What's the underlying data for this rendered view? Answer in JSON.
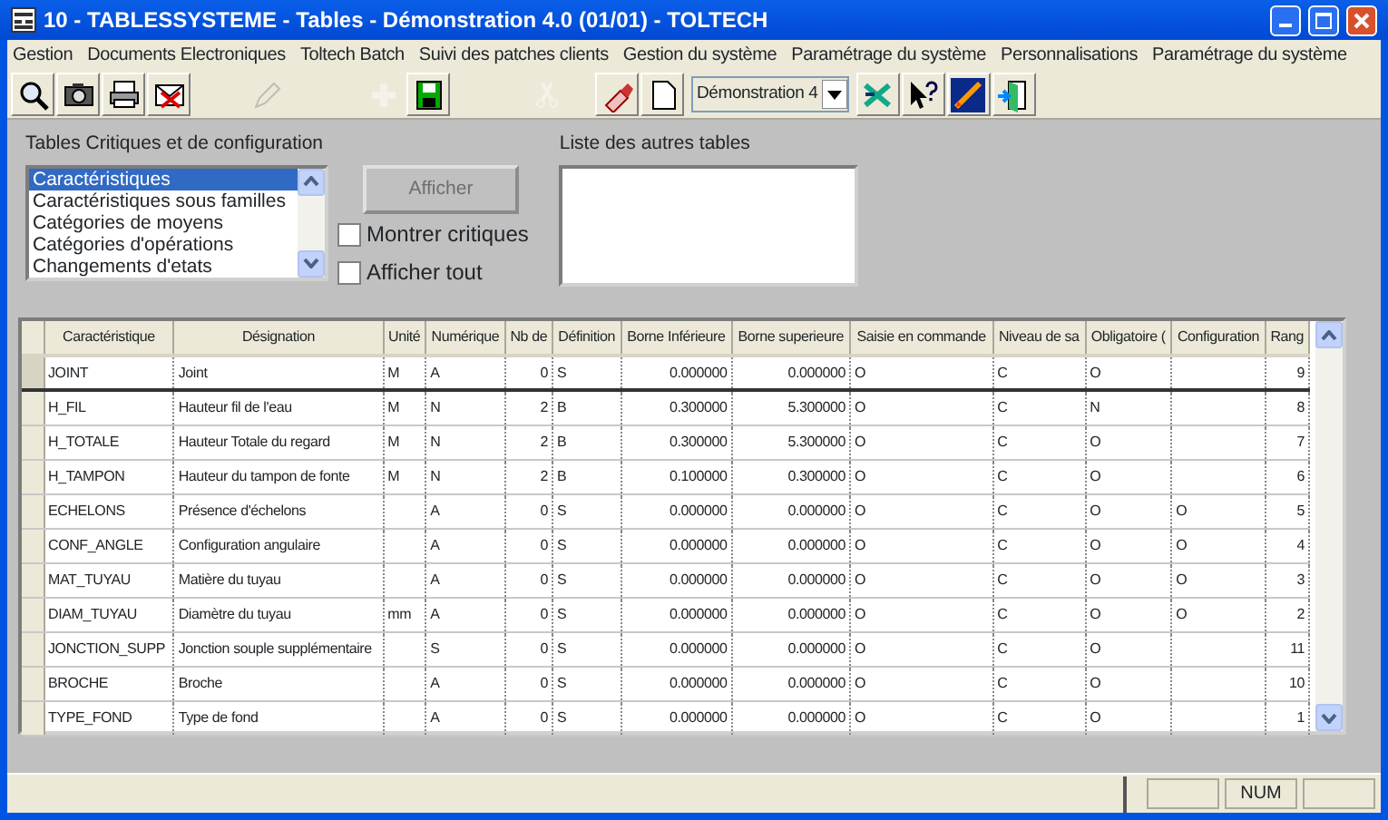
{
  "window": {
    "title": "10 - TABLESSYSTEME - Tables - Démonstration 4.0 (01/01) - TOLTECH"
  },
  "menu": [
    {
      "label": "Gestion"
    },
    {
      "label": "Documents Electroniques"
    },
    {
      "label": "Toltech Batch"
    },
    {
      "label": "Suivi des patches clients"
    },
    {
      "label": "Gestion du système"
    },
    {
      "label": "Paramétrage du système"
    },
    {
      "label": "Personnalisations"
    },
    {
      "label": "Paramétrage du système"
    }
  ],
  "toolbar": [
    {
      "disabled": false
    },
    {
      "disabled": false
    },
    {
      "disabled": false
    },
    {
      "disabled": false
    },
    {
      "disabled": true
    },
    {
      "disabled": true
    },
    {
      "disabled": false
    },
    {
      "disabled": true
    },
    {
      "disabled": false
    },
    {
      "disabled": false
    }
  ],
  "database_select": {
    "value": "Démonstration 4"
  },
  "toolbar_right": [
    {
      "disabled": false
    },
    {
      "disabled": false
    },
    {
      "disabled": false
    },
    {
      "disabled": false
    }
  ],
  "critical_tables": {
    "label": "Tables Critiques et de configuration",
    "items": [
      {
        "label": "Caractéristiques",
        "selected": true
      },
      {
        "label": "Caractéristiques sous familles",
        "selected": false
      },
      {
        "label": "Catégories de moyens",
        "selected": false
      },
      {
        "label": "Catégories d'opérations",
        "selected": false
      },
      {
        "label": "Changements d'etats",
        "selected": false
      }
    ]
  },
  "show_button": {
    "label": "Afficher",
    "disabled": true
  },
  "checkboxes": [
    {
      "label": "Montrer critiques",
      "checked": false
    },
    {
      "label": "Afficher tout",
      "checked": false
    }
  ],
  "other_tables": {
    "label": "Liste des autres tables"
  },
  "table": {
    "columns": [
      "Caractéristique",
      "Désignation",
      "Unité",
      "Numérique",
      "Nb de",
      "Définition",
      "Borne Inférieure",
      "Borne superieure",
      "Saisie en commande",
      "Niveau de sa",
      "Obligatoire (",
      "Configuration",
      "Rang"
    ],
    "rows": [
      {
        "selected": true,
        "cells": [
          "JOINT",
          "Joint",
          "M",
          "A",
          "0",
          "S",
          "0.000000",
          "0.000000",
          "O",
          "C",
          "O",
          "",
          "9"
        ]
      },
      {
        "selected": false,
        "cells": [
          "H_FIL",
          "Hauteur fil de l'eau",
          "M",
          "N",
          "2",
          "B",
          "0.300000",
          "5.300000",
          "O",
          "C",
          "N",
          "",
          "8"
        ]
      },
      {
        "selected": false,
        "cells": [
          "H_TOTALE",
          "Hauteur Totale du regard",
          "M",
          "N",
          "2",
          "B",
          "0.300000",
          "5.300000",
          "O",
          "C",
          "O",
          "",
          "7"
        ]
      },
      {
        "selected": false,
        "cells": [
          "H_TAMPON",
          "Hauteur du tampon de fonte",
          "M",
          "N",
          "2",
          "B",
          "0.100000",
          "0.300000",
          "O",
          "C",
          "O",
          "",
          "6"
        ]
      },
      {
        "selected": false,
        "cells": [
          "ECHELONS",
          "Présence d'échelons",
          "",
          "A",
          "0",
          "S",
          "0.000000",
          "0.000000",
          "O",
          "C",
          "O",
          "O",
          "5"
        ]
      },
      {
        "selected": false,
        "cells": [
          "CONF_ANGLE",
          "Configuration angulaire",
          "",
          "A",
          "0",
          "S",
          "0.000000",
          "0.000000",
          "O",
          "C",
          "O",
          "O",
          "4"
        ]
      },
      {
        "selected": false,
        "cells": [
          "MAT_TUYAU",
          "Matière du tuyau",
          "",
          "A",
          "0",
          "S",
          "0.000000",
          "0.000000",
          "O",
          "C",
          "O",
          "O",
          "3"
        ]
      },
      {
        "selected": false,
        "cells": [
          "DIAM_TUYAU",
          "Diamètre du tuyau",
          "mm",
          "A",
          "0",
          "S",
          "0.000000",
          "0.000000",
          "O",
          "C",
          "O",
          "O",
          "2"
        ]
      },
      {
        "selected": false,
        "cells": [
          "JONCTION_SUPP",
          "Jonction souple supplémentaire",
          "",
          "S",
          "0",
          "S",
          "0.000000",
          "0.000000",
          "O",
          "C",
          "O",
          "",
          "11"
        ]
      },
      {
        "selected": false,
        "cells": [
          "BROCHE",
          "Broche",
          "",
          "A",
          "0",
          "S",
          "0.000000",
          "0.000000",
          "O",
          "C",
          "O",
          "",
          "10"
        ]
      },
      {
        "selected": false,
        "cells": [
          "TYPE_FOND",
          "Type de fond",
          "",
          "A",
          "0",
          "S",
          "0.000000",
          "0.000000",
          "O",
          "C",
          "O",
          "",
          "1"
        ]
      }
    ]
  },
  "status_bar": {
    "num_indicator": "NUM"
  }
}
